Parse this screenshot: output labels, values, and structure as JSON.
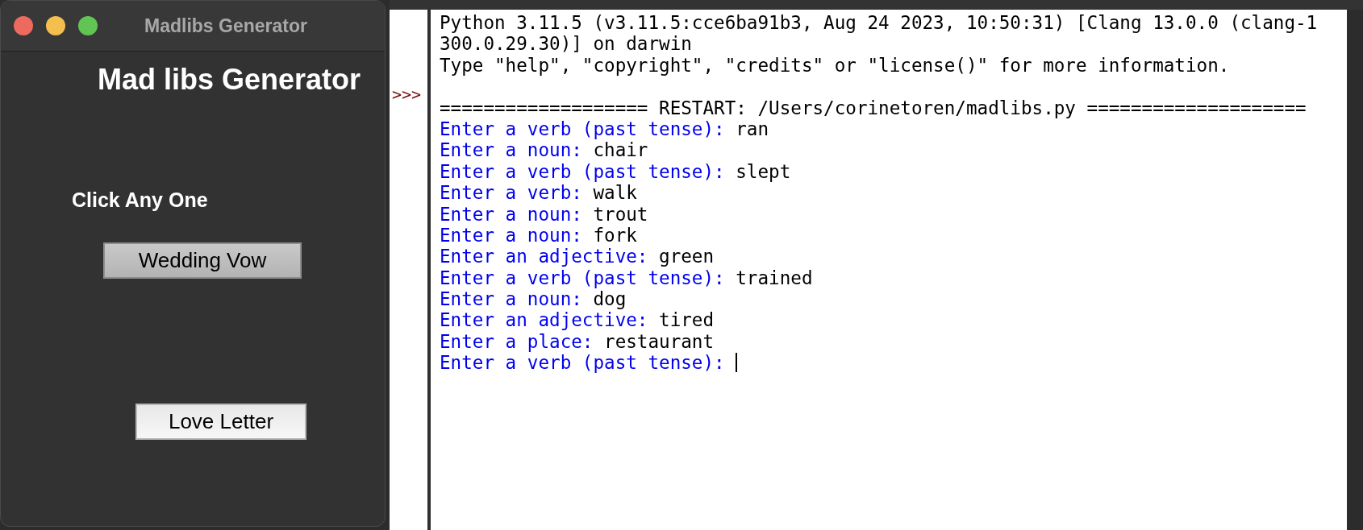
{
  "app_window": {
    "title": "Madlibs Generator",
    "heading": "Mad libs Generator",
    "instruction": "Click Any One",
    "buttons": [
      {
        "label": "Wedding Vow",
        "selected": true
      },
      {
        "label": "Love Letter",
        "selected": false
      }
    ]
  },
  "shell": {
    "prompt": ">>>",
    "lines": [
      {
        "kind": "output",
        "text": "Python 3.11.5 (v3.11.5:cce6ba91b3, Aug 24 2023, 10:50:31) [Clang 13.0.0 (clang-1"
      },
      {
        "kind": "output",
        "text": "300.0.29.30)] on darwin"
      },
      {
        "kind": "output",
        "text": "Type \"help\", \"copyright\", \"credits\" or \"license()\" for more information."
      },
      {
        "kind": "blank"
      },
      {
        "kind": "output",
        "text": "=================== RESTART: /Users/corinetoren/madlibs.py ===================="
      },
      {
        "kind": "input",
        "prompt": "Enter a verb (past tense):",
        "answer": "ran"
      },
      {
        "kind": "input",
        "prompt": "Enter a noun:",
        "answer": "chair"
      },
      {
        "kind": "input",
        "prompt": "Enter a verb (past tense):",
        "answer": "slept"
      },
      {
        "kind": "input",
        "prompt": "Enter a verb:",
        "answer": "walk"
      },
      {
        "kind": "input",
        "prompt": "Enter a noun:",
        "answer": "trout"
      },
      {
        "kind": "input",
        "prompt": "Enter a noun:",
        "answer": "fork"
      },
      {
        "kind": "input",
        "prompt": "Enter an adjective:",
        "answer": "green"
      },
      {
        "kind": "input",
        "prompt": "Enter a verb (past tense):",
        "answer": "trained"
      },
      {
        "kind": "input",
        "prompt": "Enter a noun:",
        "answer": "dog"
      },
      {
        "kind": "input",
        "prompt": "Enter an adjective:",
        "answer": "tired"
      },
      {
        "kind": "input",
        "prompt": "Enter a place:",
        "answer": "restaurant"
      },
      {
        "kind": "input",
        "prompt": "Enter a verb (past tense):",
        "cursor": true
      }
    ]
  }
}
